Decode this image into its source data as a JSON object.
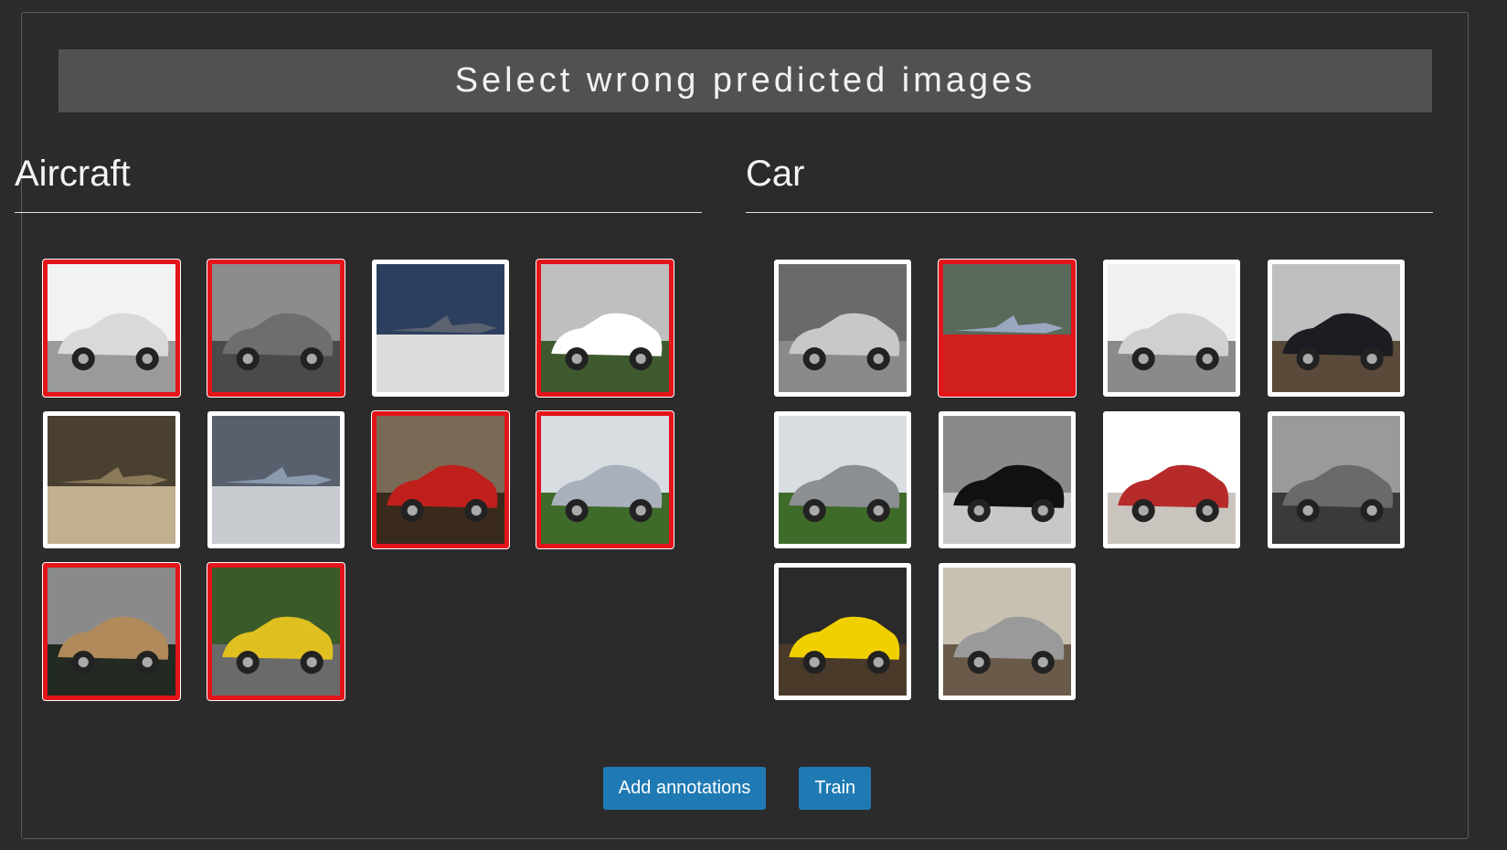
{
  "page": {
    "title": "Select wrong predicted images"
  },
  "colors": {
    "background": "#2b2b2b",
    "banner": "#515151",
    "selected_border": "#e3141a",
    "button": "#1f7ab3"
  },
  "columns": [
    {
      "label": "Aircraft",
      "images": [
        {
          "subject": "white sports car",
          "icon": "car-photo",
          "selected": true
        },
        {
          "subject": "grey station wagon",
          "icon": "car-photo",
          "selected": true
        },
        {
          "subject": "jet aircraft",
          "icon": "aircraft-photo",
          "selected": false
        },
        {
          "subject": "white city car",
          "icon": "car-photo",
          "selected": true
        },
        {
          "subject": "aircraft in hangar",
          "icon": "aircraft-photo",
          "selected": false
        },
        {
          "subject": "aircraft on tarmac",
          "icon": "aircraft-photo",
          "selected": false
        },
        {
          "subject": "red sports car",
          "icon": "car-photo",
          "selected": true
        },
        {
          "subject": "silver sedan",
          "icon": "car-photo",
          "selected": true
        },
        {
          "subject": "gold sports car",
          "icon": "car-photo",
          "selected": true
        },
        {
          "subject": "yellow coupe",
          "icon": "car-photo",
          "selected": true
        }
      ]
    },
    {
      "label": "Car",
      "images": [
        {
          "subject": "silver coupe",
          "icon": "car-photo",
          "selected": false
        },
        {
          "subject": "airliner at airport",
          "icon": "aircraft-photo",
          "selected": true
        },
        {
          "subject": "silver muscle car",
          "icon": "car-photo",
          "selected": false
        },
        {
          "subject": "black minivan",
          "icon": "car-photo",
          "selected": false
        },
        {
          "subject": "grey sedan",
          "icon": "car-photo",
          "selected": false
        },
        {
          "subject": "black luxury sedan",
          "icon": "car-photo",
          "selected": false
        },
        {
          "subject": "red sports car",
          "icon": "car-photo",
          "selected": false
        },
        {
          "subject": "grey SUV",
          "icon": "car-photo",
          "selected": false
        },
        {
          "subject": "yellow sports car",
          "icon": "car-photo",
          "selected": false
        },
        {
          "subject": "silver luxury sedan",
          "icon": "car-photo",
          "selected": false
        }
      ]
    }
  ],
  "actions": {
    "add_label": "Add annotations",
    "train_label": "Train"
  }
}
